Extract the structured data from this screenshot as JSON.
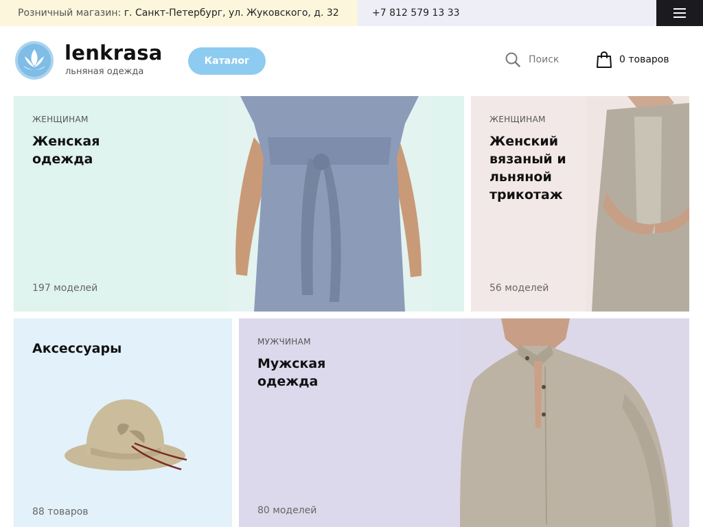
{
  "topbar": {
    "address_prefix": "Розничный магазин:",
    "address": "г. Санкт-Петербург, ул. Жуковского, д. 32",
    "phone": "+7 812 579 13 33",
    "menu_icon": "hamburger-icon"
  },
  "header": {
    "logo_name": "lenkrasa",
    "logo_sub": "льняная одежда",
    "catalog_label": "Каталог",
    "search_label": "Поиск",
    "cart_label": "0 товаров"
  },
  "tiles": [
    {
      "kicker": "ЖЕНЩИНАМ",
      "title": "Женская одежда",
      "count": "197 моделей"
    },
    {
      "kicker": "ЖЕНЩИНАМ",
      "title": "Женский вязаный и льняной трикотаж",
      "count": "56 моделей"
    },
    {
      "kicker": "",
      "title": "Аксессуары",
      "count": "88 товаров"
    },
    {
      "kicker": "МУЖЧИНАМ",
      "title": "Мужская одежда",
      "count": "80 моделей"
    }
  ],
  "colors": {
    "catalog_button": "#8ecbf0",
    "tile_women": "#dff3ef",
    "tile_knit": "#f3e8e8",
    "tile_accessories": "#e3f1fa",
    "tile_men": "#dcd9ec",
    "address_bar": "#fbf6dc"
  }
}
